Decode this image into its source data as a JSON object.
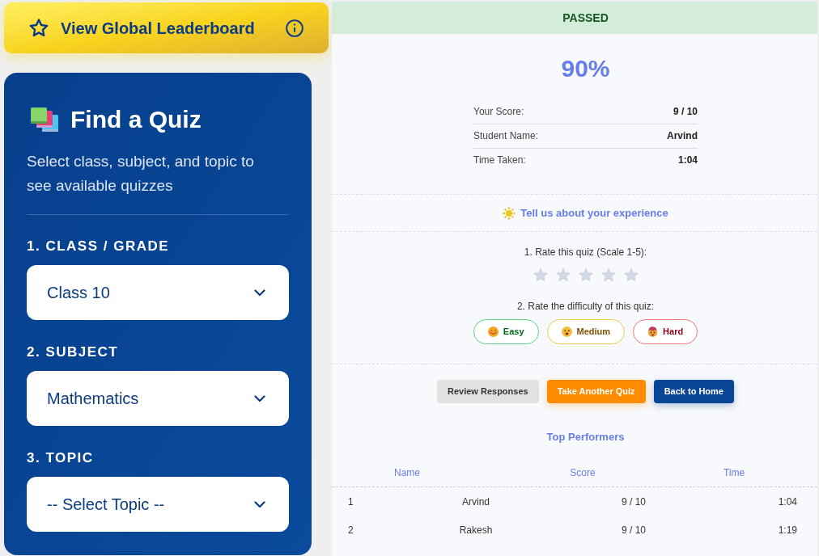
{
  "leaderboard_button": {
    "label": "View Global Leaderboard"
  },
  "quiz_finder": {
    "title": "Find a Quiz",
    "subtitle": "Select class, subject, and topic to see available quizzes",
    "fields": [
      {
        "label": "1. CLASS / GRADE",
        "value": "Class 10"
      },
      {
        "label": "2. SUBJECT",
        "value": "Mathematics"
      },
      {
        "label": "3. TOPIC",
        "value": "-- Select Topic --"
      }
    ]
  },
  "result": {
    "status": "PASSED",
    "percentage": "90%",
    "details": [
      {
        "label": "Your Score:",
        "value": "9 / 10"
      },
      {
        "label": "Student Name:",
        "value": "Arvind"
      },
      {
        "label": "Time Taken:",
        "value": "1:04"
      }
    ]
  },
  "feedback": {
    "heading": "Tell us about your experience",
    "rating_prompt": "1. Rate this quiz (Scale 1-5):",
    "stars": 0,
    "difficulty_prompt": "2. Rate the difficulty of this quiz:",
    "difficulty_options": [
      {
        "label": "Easy",
        "selected": false,
        "color": "#5cd08a"
      },
      {
        "label": "Medium",
        "selected": false,
        "color": "#f0c94a"
      },
      {
        "label": "Hard",
        "selected": false,
        "color": "#ef7575"
      }
    ]
  },
  "actions": [
    {
      "label": "Review Responses",
      "kind": "secondary"
    },
    {
      "label": "Take Another Quiz",
      "kind": "accent"
    },
    {
      "label": "Back to Home",
      "kind": "primary"
    }
  ],
  "top_performers": {
    "title": "Top Performers",
    "columns": [
      "Name",
      "Score",
      "Time"
    ],
    "rows": [
      [
        "1",
        "Arvind",
        "9 / 10",
        "1:04"
      ],
      [
        "2",
        "Rakesh",
        "9 / 10",
        "1:19"
      ]
    ]
  }
}
